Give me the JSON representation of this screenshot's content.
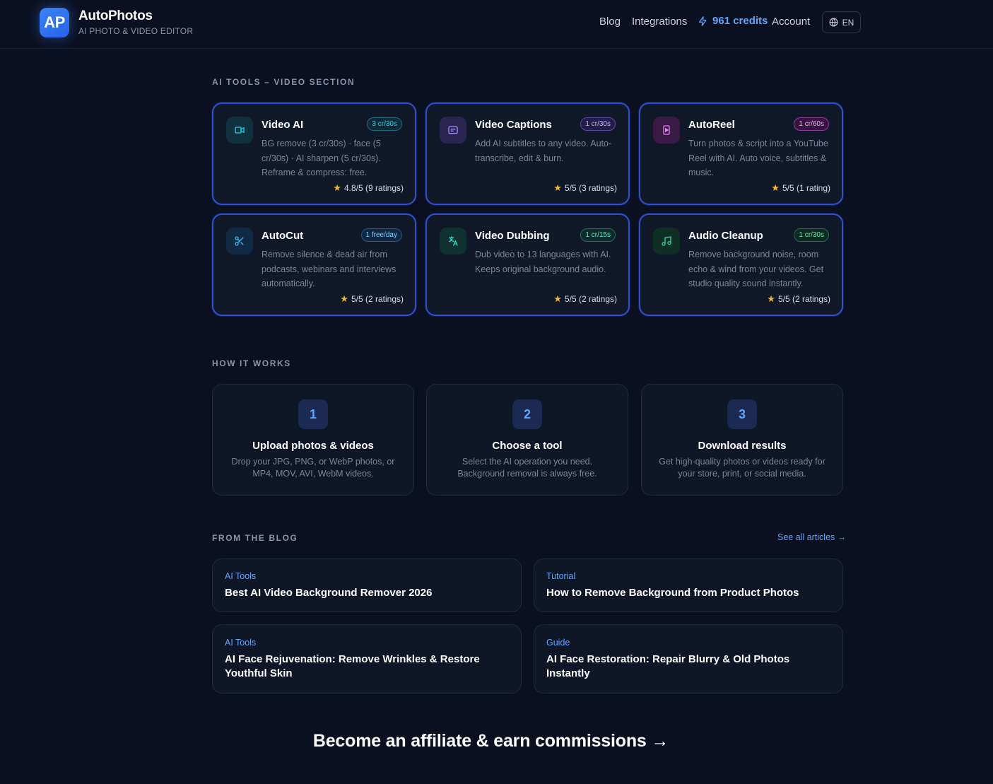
{
  "header": {
    "logo_text": "AP",
    "brand_name": "AutoPhotos",
    "brand_sub": "AI PHOTO & VIDEO EDITOR",
    "nav": {
      "blog": "Blog",
      "integrations": "Integrations",
      "credits": "961 credits",
      "account": "Account",
      "lang": "EN"
    }
  },
  "tools_section": {
    "label": "AI TOOLS – VIDEO SECTION",
    "tools": [
      {
        "title": "Video AI",
        "badge": "3 cr/30s",
        "desc": "BG remove (3 cr/30s) · face (5 cr/30s) · AI sharpen (5 cr/30s). Reframe & compress: free.",
        "rating": "4.8/5 (9 ratings)",
        "icon": "video-camera-icon",
        "accent": "#22d3ee"
      },
      {
        "title": "Video Captions",
        "badge": "1 cr/30s",
        "desc": "Add AI subtitles to any video. Auto-transcribe, edit & burn.",
        "rating": "5/5 (3 ratings)",
        "icon": "captions-icon",
        "accent": "#a78bfa"
      },
      {
        "title": "AutoReel",
        "badge": "1 cr/60s",
        "desc": "Turn photos & script into a YouTube Reel with AI. Auto voice, subtitles & music.",
        "rating": "5/5 (1 rating)",
        "icon": "reel-icon",
        "accent": "#e879f9"
      },
      {
        "title": "AutoCut",
        "badge": "1 free/day",
        "desc": "Remove silence & dead air from podcasts, webinars and interviews automatically.",
        "rating": "5/5 (2 ratings)",
        "icon": "scissors-icon",
        "accent": "#38bdf8"
      },
      {
        "title": "Video Dubbing",
        "badge": "1 cr/15s",
        "desc": "Dub video to 13 languages with AI. Keeps original background audio.",
        "rating": "5/5 (2 ratings)",
        "icon": "translate-icon",
        "accent": "#2dd4bf"
      },
      {
        "title": "Audio Cleanup",
        "badge": "1 cr/30s",
        "desc": "Remove background noise, room echo & wind from your videos. Get studio quality sound instantly.",
        "rating": "5/5 (2 ratings)",
        "icon": "music-note-icon",
        "accent": "#34d399"
      }
    ]
  },
  "how_it_works": {
    "label": "HOW IT WORKS",
    "steps": [
      {
        "num": "1",
        "title": "Upload photos & videos",
        "desc": "Drop your JPG, PNG, or WebP photos, or MP4, MOV, AVI, WebM videos."
      },
      {
        "num": "2",
        "title": "Choose a tool",
        "desc": "Select the AI operation you need. Background removal is always free."
      },
      {
        "num": "3",
        "title": "Download results",
        "desc": "Get high-quality photos or videos ready for your store, print, or social media."
      }
    ]
  },
  "blog": {
    "label": "FROM THE BLOG",
    "see_all": "See all articles →",
    "posts": [
      {
        "category": "AI Tools",
        "title": "Best AI Video Background Remover 2026"
      },
      {
        "category": "Tutorial",
        "title": "How to Remove Background from Product Photos"
      },
      {
        "category": "AI Tools",
        "title": "AI Face Rejuvenation: Remove Wrinkles & Restore Youthful Skin"
      },
      {
        "category": "Guide",
        "title": "AI Face Restoration: Repair Blurry & Old Photos Instantly"
      }
    ]
  },
  "affiliate": "Become an affiliate & earn commissions →"
}
